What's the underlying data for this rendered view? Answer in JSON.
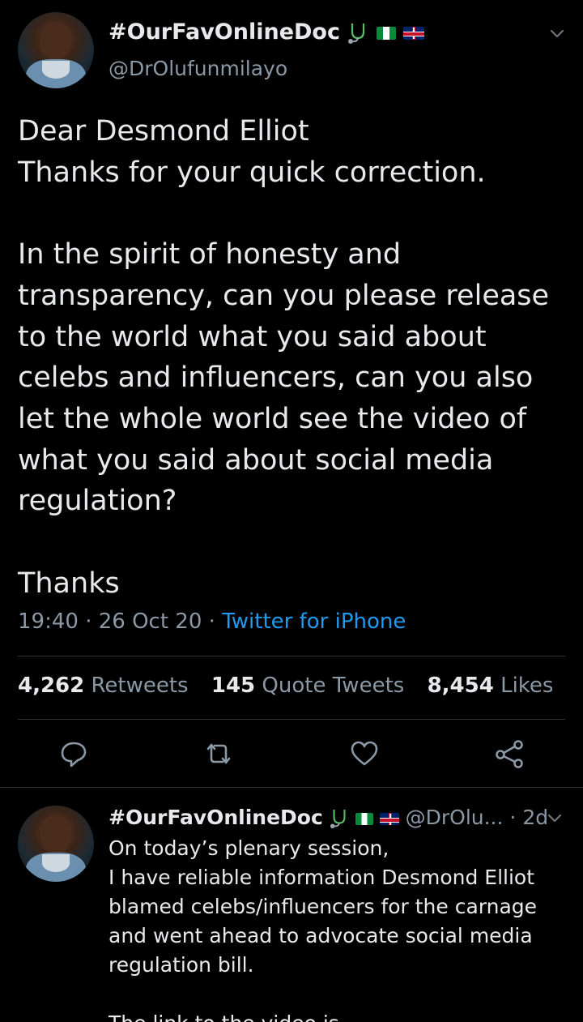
{
  "main_tweet": {
    "display_name": "#OurFavOnlineDoc",
    "handle": "@DrOlufunmilayo",
    "text": "Dear Desmond Elliot\nThanks for your quick correction.\n\nIn the spirit of honesty and transparency, can you please release to the world what you said about celebs and influencers, can you also let the whole world see the video of what you said about social media regulation?\n\nThanks",
    "time": "19:40",
    "sep1": "·",
    "date": "26 Oct 20",
    "sep2": "·",
    "source": "Twitter for iPhone",
    "retweets_count": "4,262",
    "retweets_label": "Retweets",
    "quote_count": "145",
    "quote_label": "Quote Tweets",
    "likes_count": "8,454",
    "likes_label": "Likes"
  },
  "reply_tweet": {
    "display_name": "#OurFavOnlineDoc",
    "handle": "@DrOlu...",
    "sep": "·",
    "age": "2d",
    "text": "On today’s plenary session,\nI have reliable information Desmond Elliot blamed celebs/influencers for the carnage and went ahead to advocate social media regulation bill.\n\nThe link to the video is"
  },
  "icons": {
    "verified_emoji": "stethoscope-icon",
    "flag_1": "nigeria-flag",
    "flag_2": "uk-flag",
    "more": "chevron-down-icon",
    "reply": "reply-icon",
    "retweet": "retweet-icon",
    "like": "heart-icon",
    "share": "share-icon"
  },
  "colors": {
    "background": "#000000",
    "text": "#e7e9ea",
    "muted": "#8b98a5",
    "link": "#1d9bf0",
    "divider": "#2f3336"
  }
}
